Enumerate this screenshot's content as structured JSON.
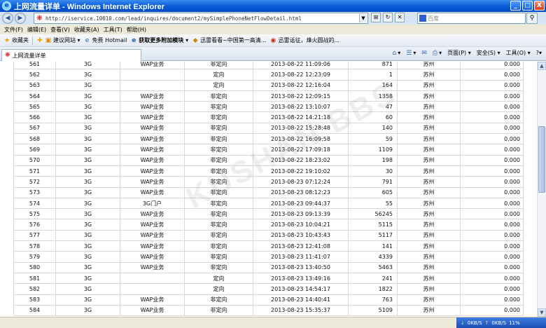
{
  "window": {
    "title": "上网流量详单 - Windows Internet Explorer",
    "buttons": [
      "_",
      "□",
      "X"
    ]
  },
  "address": {
    "url": "http://iservice.10010.com/lead/inquires/document2/mySimplePhoneNetFlowDetail.html",
    "search_placeholder": "百度"
  },
  "menu": {
    "items": [
      "文件(F)",
      "编辑(E)",
      "查看(V)",
      "收藏夹(A)",
      "工具(T)",
      "帮助(H)"
    ]
  },
  "favorites": {
    "label": "收藏夹",
    "items": [
      "建议网站 ▾",
      "免费 Hotmail",
      "获取更多附加模块 ▾",
      "迅雷看看~中国第一高清...",
      "迅雷话征，烽火圆战的..."
    ]
  },
  "tab": {
    "title": "上网流量详单"
  },
  "commands": {
    "page": "页面(P) ▾",
    "safety": "安全(S) ▾",
    "tools": "工具(O) ▾",
    "help": "?▾"
  },
  "table": {
    "rows": [
      [
        "561",
        "3G",
        "WAP业务",
        "非定向",
        "2013-08-22 11:09:06",
        "871",
        "苏州",
        "0.000"
      ],
      [
        "562",
        "3G",
        "",
        "定向",
        "2013-08-22 12:23:09",
        "1",
        "苏州",
        "0.000"
      ],
      [
        "563",
        "3G",
        "",
        "定向",
        "2013-08-22 12:16:04",
        "164",
        "苏州",
        "0.000"
      ],
      [
        "564",
        "3G",
        "WAP业务",
        "非定向",
        "2013-08-22 12:09:15",
        "1358",
        "苏州",
        "0.000"
      ],
      [
        "565",
        "3G",
        "WAP业务",
        "非定向",
        "2013-08-22 13:10:07",
        "47",
        "苏州",
        "0.000"
      ],
      [
        "566",
        "3G",
        "WAP业务",
        "非定向",
        "2013-08-22 14:21:18",
        "60",
        "苏州",
        "0.000"
      ],
      [
        "567",
        "3G",
        "WAP业务",
        "非定向",
        "2013-08-22 15:28:48",
        "140",
        "苏州",
        "0.000"
      ],
      [
        "568",
        "3G",
        "WAP业务",
        "非定向",
        "2013-08-22 16:09:58",
        "59",
        "苏州",
        "0.000"
      ],
      [
        "569",
        "3G",
        "WAP业务",
        "非定向",
        "2013-08-22 17:09:18",
        "1109",
        "苏州",
        "0.000"
      ],
      [
        "570",
        "3G",
        "WAP业务",
        "非定向",
        "2013-08-22 18:23:02",
        "198",
        "苏州",
        "0.000"
      ],
      [
        "571",
        "3G",
        "WAP业务",
        "非定向",
        "2013-08-22 19:10:02",
        "30",
        "苏州",
        "0.000"
      ],
      [
        "572",
        "3G",
        "WAP业务",
        "非定向",
        "2013-08-23 07:12:24",
        "791",
        "苏州",
        "0.000"
      ],
      [
        "573",
        "3G",
        "WAP业务",
        "非定向",
        "2013-08-23 08:12:23",
        "605",
        "苏州",
        "0.000"
      ],
      [
        "574",
        "3G",
        "3G门户",
        "非定向",
        "2013-08-23 09:44:37",
        "55",
        "苏州",
        "0.000"
      ],
      [
        "575",
        "3G",
        "WAP业务",
        "非定向",
        "2013-08-23 09:13:39",
        "56245",
        "苏州",
        "0.000"
      ],
      [
        "576",
        "3G",
        "WAP业务",
        "非定向",
        "2013-08-23 10:04:21",
        "5115",
        "苏州",
        "0.000"
      ],
      [
        "577",
        "3G",
        "WAP业务",
        "非定向",
        "2013-08-23 10:43:43",
        "5117",
        "苏州",
        "0.000"
      ],
      [
        "578",
        "3G",
        "WAP业务",
        "非定向",
        "2013-08-23 12:41:08",
        "141",
        "苏州",
        "0.000"
      ],
      [
        "579",
        "3G",
        "WAP业务",
        "非定向",
        "2013-08-23 11:41:07",
        "4339",
        "苏州",
        "0.000"
      ],
      [
        "580",
        "3G",
        "WAP业务",
        "非定向",
        "2013-08-23 13:40:50",
        "5463",
        "苏州",
        "0.000"
      ],
      [
        "581",
        "3G",
        "",
        "定向",
        "2013-08-23 13:49:16",
        "241",
        "苏州",
        "0.000"
      ],
      [
        "582",
        "3G",
        "",
        "定向",
        "2013-08-23 14:54:17",
        "1822",
        "苏州",
        "0.000"
      ],
      [
        "583",
        "3G",
        "WAP业务",
        "非定向",
        "2013-08-23 14:40:41",
        "763",
        "苏州",
        "0.000"
      ],
      [
        "584",
        "3G",
        "WAP业务",
        "非定向",
        "2013-08-23 15:35:37",
        "5109",
        "苏州",
        "0.000"
      ]
    ]
  },
  "watermark": "KUSHAN BBS",
  "netmeter": {
    "down": "0KB/S",
    "up": "0KB/S",
    "extra": "11%"
  }
}
